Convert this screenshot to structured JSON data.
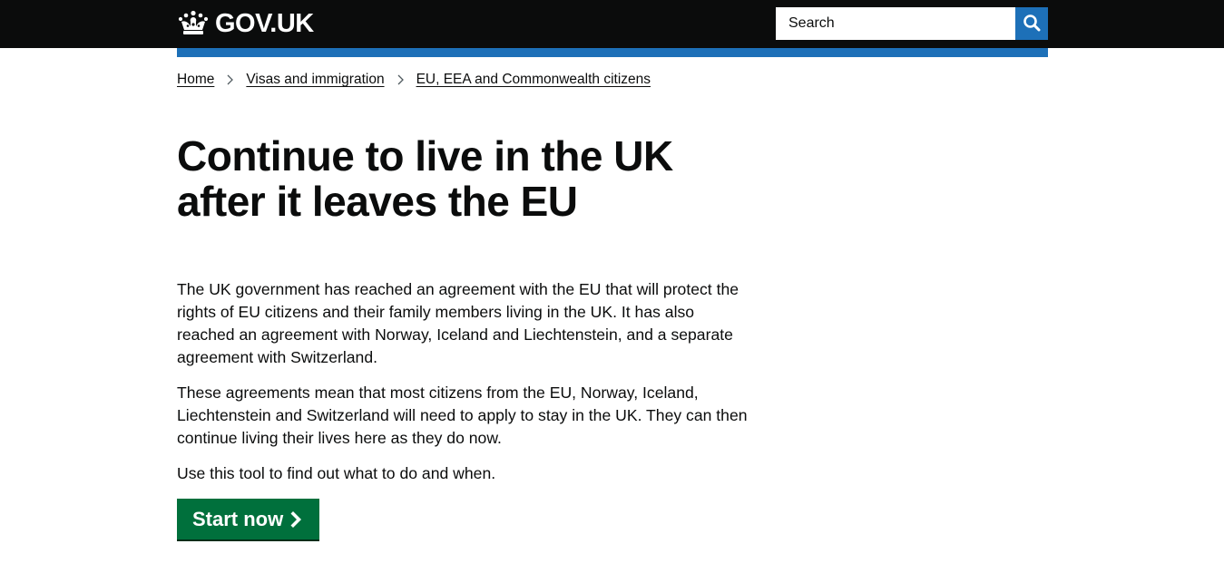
{
  "header": {
    "logo_text": "GOV.UK",
    "logo_icon": "crown-icon",
    "search": {
      "placeholder": "Search",
      "button_icon": "search-icon"
    }
  },
  "breadcrumbs": [
    {
      "label": "Home"
    },
    {
      "label": "Visas and immigration"
    },
    {
      "label": "EU, EEA and Commonwealth citizens"
    }
  ],
  "page": {
    "title": "Continue to live in the UK after it leaves the EU",
    "paragraphs": [
      "The UK government has reached an agreement with the EU that will protect the rights of EU citizens and their family members living in the UK. It has also reached an agreement with Norway, Iceland and Liechtenstein, and a separate agreement with Switzerland.",
      "These agreements mean that most citizens from the EU, Norway, Iceland, Liechtenstein and Switzerland will need to apply to stay in the UK. They can then continue living their lives here as they do now.",
      "Use this tool to find out what to do and when."
    ],
    "start_button": {
      "label": "Start now",
      "icon": "chevron-right-icon"
    }
  },
  "colors": {
    "header_bg": "#0b0c0c",
    "brand_blue": "#1d70b8",
    "start_green": "#00703c",
    "text": "#0b0c0c"
  }
}
